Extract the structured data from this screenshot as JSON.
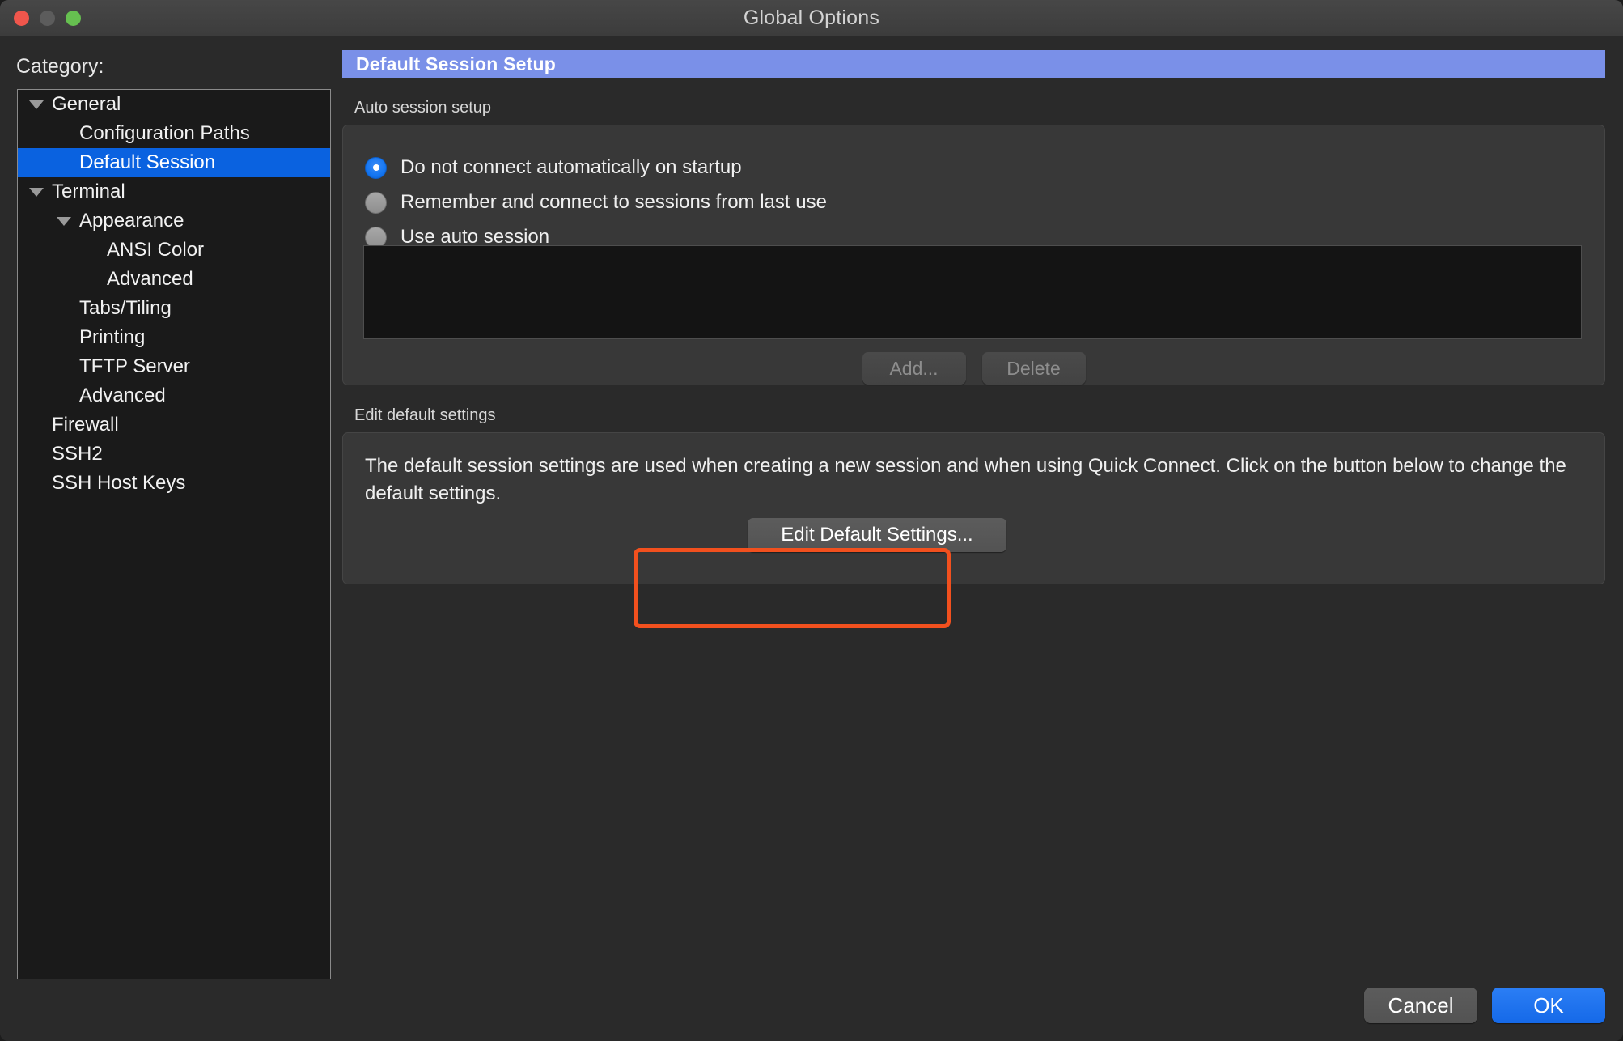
{
  "window": {
    "title": "Global Options",
    "traffic_lights": [
      "close-button",
      "minimize-button",
      "maximize-button"
    ]
  },
  "sidebar": {
    "label": "Category:",
    "items": [
      {
        "label": "General",
        "depth": 0,
        "twisty": "expanded",
        "selected": false
      },
      {
        "label": "Configuration Paths",
        "depth": 1,
        "twisty": "none",
        "selected": false
      },
      {
        "label": "Default Session",
        "depth": 1,
        "twisty": "none",
        "selected": true
      },
      {
        "label": "Terminal",
        "depth": 0,
        "twisty": "expanded",
        "selected": false
      },
      {
        "label": "Appearance",
        "depth": 1,
        "twisty": "expanded",
        "selected": false
      },
      {
        "label": "ANSI Color",
        "depth": 2,
        "twisty": "none",
        "selected": false
      },
      {
        "label": "Advanced",
        "depth": 2,
        "twisty": "none",
        "selected": false
      },
      {
        "label": "Tabs/Tiling",
        "depth": 1,
        "twisty": "none",
        "selected": false
      },
      {
        "label": "Printing",
        "depth": 1,
        "twisty": "none",
        "selected": false
      },
      {
        "label": "TFTP Server",
        "depth": 1,
        "twisty": "none",
        "selected": false
      },
      {
        "label": "Advanced",
        "depth": 1,
        "twisty": "none",
        "selected": false
      },
      {
        "label": "Firewall",
        "depth": 0,
        "twisty": "none",
        "selected": false
      },
      {
        "label": "SSH2",
        "depth": 0,
        "twisty": "none",
        "selected": false
      },
      {
        "label": "SSH Host Keys",
        "depth": 0,
        "twisty": "none",
        "selected": false
      }
    ]
  },
  "main": {
    "header": "Default Session Setup",
    "auto_session": {
      "group_title": "Auto session setup",
      "radios": [
        {
          "label": "Do not connect automatically on startup",
          "selected": true
        },
        {
          "label": "Remember and connect to sessions from last use",
          "selected": false
        },
        {
          "label": "Use auto session",
          "selected": false
        }
      ],
      "list_items": [],
      "add_label": "Add...",
      "add_enabled": false,
      "delete_label": "Delete",
      "delete_enabled": false
    },
    "edit_default": {
      "group_title": "Edit default settings",
      "description": "The default session settings are used when creating a new session and when using Quick Connect.  Click on the button below to change the default settings.",
      "button_label": "Edit Default Settings...",
      "annotation_color": "#f2501e"
    }
  },
  "footer": {
    "cancel_label": "Cancel",
    "ok_label": "OK"
  },
  "colors": {
    "window_bg": "#2a2a2a",
    "titlebar": "#3f3f3f",
    "header_banner": "#7a90e8",
    "selection_blue": "#0a62e0",
    "ok_blue": "#1569e8",
    "annotation_orange": "#f2501e",
    "tree_bg": "#1a1a1a",
    "listbox_bg": "#141414"
  }
}
